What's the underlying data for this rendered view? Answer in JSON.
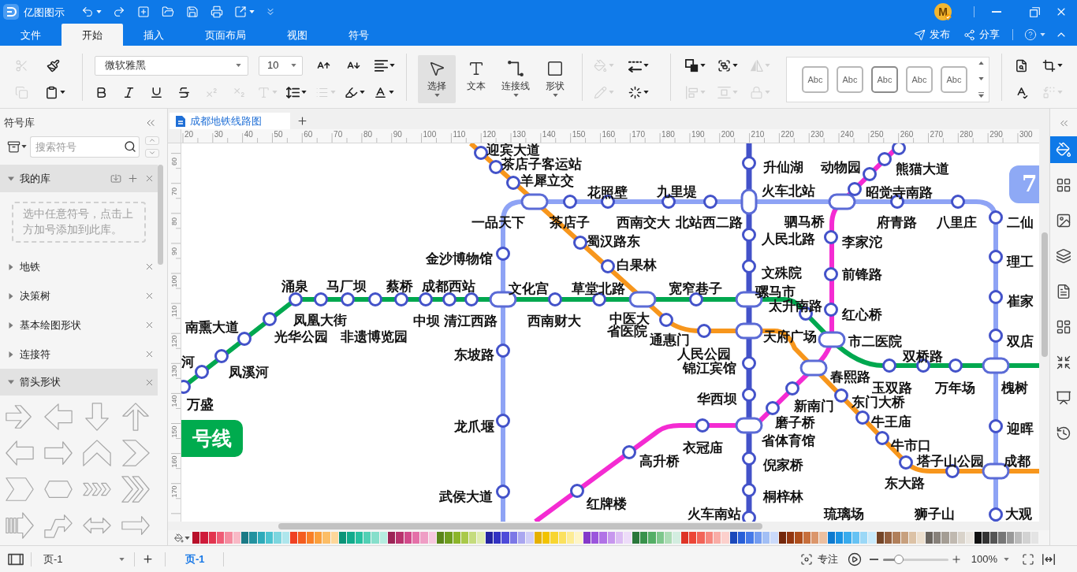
{
  "title_bar": {
    "app_name": "亿图图示",
    "avatar_initial": "M"
  },
  "menu": {
    "tabs": [
      {
        "label": "文件",
        "selected": false
      },
      {
        "label": "开始",
        "selected": true
      },
      {
        "label": "插入",
        "selected": false
      },
      {
        "label": "页面布局",
        "selected": false
      },
      {
        "label": "视图",
        "selected": false
      },
      {
        "label": "符号",
        "selected": false
      }
    ],
    "actions": [
      {
        "kind": "publish",
        "label": "发布"
      },
      {
        "kind": "share",
        "label": "分享"
      }
    ]
  },
  "toolbar": {
    "clipboard": [
      {
        "kind": "cut",
        "disabled": true
      },
      {
        "kind": "format_painter",
        "disabled": false
      },
      {
        "kind": "copy",
        "disabled": true
      },
      {
        "kind": "paste",
        "disabled": false
      }
    ],
    "font_family": "微软雅黑",
    "font_size": "10",
    "font_tools": [
      {
        "kind": "grow_font",
        "disabled": false
      },
      {
        "kind": "shrink_font",
        "disabled": false
      },
      {
        "kind": "align_text",
        "disabled": false
      }
    ],
    "format_tools": [
      {
        "kind": "bold",
        "disabled": false
      },
      {
        "kind": "italic",
        "disabled": false
      },
      {
        "kind": "underline",
        "disabled": false
      },
      {
        "kind": "strikethrough",
        "disabled": false
      },
      {
        "kind": "superscript",
        "disabled": true
      },
      {
        "kind": "subscript",
        "disabled": true
      },
      {
        "kind": "text_style",
        "disabled": true
      },
      {
        "kind": "line_spacing",
        "disabled": false
      },
      {
        "kind": "bullets",
        "disabled": true
      },
      {
        "kind": "highlight",
        "disabled": false
      },
      {
        "kind": "font_color",
        "disabled": false
      }
    ],
    "tools": [
      {
        "kind": "select",
        "label": "选择",
        "selected": true
      },
      {
        "kind": "text",
        "label": "文本",
        "selected": false
      },
      {
        "kind": "connector",
        "label": "连接线",
        "selected": false
      },
      {
        "kind": "shape",
        "label": "形状",
        "selected": false
      }
    ],
    "shape_style": [
      {
        "kind": "fill",
        "disabled": true
      },
      {
        "kind": "line_style",
        "disabled": false
      },
      {
        "kind": "line_color",
        "disabled": true
      },
      {
        "kind": "effects",
        "disabled": false
      }
    ],
    "arrange": [
      {
        "kind": "bring_front",
        "disabled": false
      },
      {
        "kind": "group",
        "disabled": false
      },
      {
        "kind": "flip",
        "disabled": true
      },
      {
        "kind": "align_objects",
        "disabled": true
      },
      {
        "kind": "distribute",
        "disabled": true
      },
      {
        "kind": "lock",
        "disabled": true
      }
    ],
    "style_presets": [
      "Abc",
      "Abc",
      "Abc",
      "Abc",
      "Abc"
    ],
    "extras": [
      {
        "kind": "find",
        "disabled": false
      },
      {
        "kind": "crop",
        "disabled": false
      },
      {
        "kind": "spellcheck",
        "disabled": false
      },
      {
        "kind": "replace",
        "disabled": true
      }
    ]
  },
  "sidebar": {
    "title": "符号库",
    "search": {
      "placeholder": "搜索符号"
    },
    "my_library": {
      "title": "我的库",
      "expanded": true,
      "hint": "选中任意符号，点击上方加号添加到此库。"
    },
    "libraries": [
      {
        "title": "地铁",
        "expanded": false
      },
      {
        "title": "决策树",
        "expanded": false
      },
      {
        "title": "基本绘图形状",
        "expanded": false
      },
      {
        "title": "连接符",
        "expanded": false
      },
      {
        "title": "箭头形状",
        "expanded": true
      }
    ]
  },
  "document_tabs": [
    {
      "title": "成都地铁线路图",
      "selected": true
    }
  ],
  "ruler": {
    "x_ticks": [
      "20",
      "30",
      "40",
      "50",
      "60",
      "70",
      "80",
      "90",
      "100",
      "110",
      "120",
      "130",
      "140",
      "150",
      "160",
      "170",
      "180",
      "190",
      "200",
      "210",
      "220",
      "230",
      "240",
      "250",
      "260",
      "270",
      "280",
      "290",
      "300"
    ],
    "y_ticks": [
      "60",
      "70",
      "80",
      "90",
      "100",
      "110",
      "120",
      "130",
      "140",
      "150",
      "160",
      "170"
    ]
  },
  "map": {
    "lines": [
      {
        "color": "#4352c9"
      },
      {
        "color": "#8ea3f5"
      },
      {
        "color": "#00a84f"
      },
      {
        "color": "#f7961c"
      },
      {
        "color": "#f42bd2"
      }
    ],
    "stations": [
      "迎宾大道",
      "茶店子客运站",
      "升仙湖",
      "动物园",
      "熊猫大道",
      "羊犀立交",
      "花照壁",
      "九里堤",
      "火车北站",
      "昭觉寺南路",
      "一品天下",
      "茶店子",
      "西南交大",
      "北站西二路",
      "驷马桥",
      "府青路",
      "八里庄",
      "二仙",
      "蜀汉路东",
      "人民北路",
      "李家沱",
      "金沙博物馆",
      "白果林",
      "理工",
      "文殊院",
      "前锋路",
      "涌泉",
      "马厂坝",
      "蔡桥",
      "成都西站",
      "文化宫",
      "草堂北路",
      "宽窄巷子",
      "骡马市",
      "太升南路",
      "崔家",
      "南熏大道",
      "凤凰大街",
      "中坝",
      "清江西路",
      "西南财大",
      "中医大",
      "红心桥",
      "光华公园",
      "非遗博览园",
      "省医院",
      "通惠门",
      "天府广场",
      "市二医院",
      "双店",
      "河",
      "东坡路",
      "人民公园",
      "双桥路",
      "凤溪河",
      "锦江宾馆",
      "春熙路",
      "玉双路",
      "万年场",
      "槐树",
      "万盛",
      "华西坝",
      "新南门",
      "东门大桥",
      "龙爪堰",
      "磨子桥",
      "牛王庙",
      "迎晖",
      "衣冠庙",
      "省体育馆",
      "牛市口",
      "高升桥",
      "倪家桥",
      "塔子山公园",
      "成都",
      "东大路",
      "武侯大道",
      "红牌楼",
      "桐梓林",
      "火车南站",
      "琉璃场",
      "狮子山",
      "大观"
    ],
    "badges": [
      {
        "text": "号线",
        "color": "#00ab4e"
      },
      {
        "text": "7",
        "color": "#8ea9f5"
      }
    ]
  },
  "right_panel": [
    {
      "kind": "style",
      "selected": true
    },
    {
      "kind": "symbols",
      "selected": false
    },
    {
      "kind": "image",
      "selected": false
    },
    {
      "kind": "layers",
      "selected": false
    },
    {
      "kind": "page",
      "selected": false
    },
    {
      "kind": "data",
      "selected": false
    },
    {
      "kind": "fit",
      "selected": false
    },
    {
      "kind": "present",
      "selected": false
    },
    {
      "kind": "history",
      "selected": false
    }
  ],
  "palette": [
    {
      "color": "#b8102a"
    },
    {
      "color": "#cf1b3a"
    },
    {
      "color": "#e2354f"
    },
    {
      "color": "#ef5c76"
    },
    {
      "color": "#f58ca0"
    },
    {
      "color": "#f9b9c6"
    },
    {
      "color": "#1b7a86"
    },
    {
      "color": "#23929f"
    },
    {
      "color": "#2eabba"
    },
    {
      "color": "#4cc3d0"
    },
    {
      "color": "#7dd6df"
    },
    {
      "color": "#aee6ec"
    },
    {
      "color": "#ef4123"
    },
    {
      "color": "#f45d1f"
    },
    {
      "color": "#f97f27"
    },
    {
      "color": "#fb9f3c"
    },
    {
      "color": "#fcbd66"
    },
    {
      "color": "#fdd79a"
    },
    {
      "color": "#0b9478"
    },
    {
      "color": "#12ab8c"
    },
    {
      "color": "#27c0a0"
    },
    {
      "color": "#52d0b5"
    },
    {
      "color": "#86dfcb"
    },
    {
      "color": "#b6ece0"
    },
    {
      "color": "#9c2456"
    },
    {
      "color": "#b8336d"
    },
    {
      "color": "#d24a8b"
    },
    {
      "color": "#e470a8"
    },
    {
      "color": "#ef9ec5"
    },
    {
      "color": "#f7c8de"
    },
    {
      "color": "#5a8519"
    },
    {
      "color": "#6f9d1f"
    },
    {
      "color": "#8cb52a"
    },
    {
      "color": "#a9c94a"
    },
    {
      "color": "#c5dc7e"
    },
    {
      "color": "#dfecb0"
    },
    {
      "color": "#2424a0"
    },
    {
      "color": "#3333c2"
    },
    {
      "color": "#4e4bd9"
    },
    {
      "color": "#7c78e6"
    },
    {
      "color": "#aaa7f0"
    },
    {
      "color": "#d0cef7"
    },
    {
      "color": "#e5b000"
    },
    {
      "color": "#f2c300"
    },
    {
      "color": "#f8d530"
    },
    {
      "color": "#fbe15f"
    },
    {
      "color": "#fdec95"
    },
    {
      "color": "#fef5c6"
    },
    {
      "color": "#8439c9"
    },
    {
      "color": "#9b55dc"
    },
    {
      "color": "#b173e6"
    },
    {
      "color": "#c797ee"
    },
    {
      "color": "#dcbdf4"
    },
    {
      "color": "#eddcf9"
    },
    {
      "color": "#2a773b"
    },
    {
      "color": "#38924b"
    },
    {
      "color": "#54ae66"
    },
    {
      "color": "#7ec78c"
    },
    {
      "color": "#acdcb5"
    },
    {
      "color": "#d3ede0"
    },
    {
      "color": "#de3427"
    },
    {
      "color": "#ec4637"
    },
    {
      "color": "#f26458"
    },
    {
      "color": "#f6877e"
    },
    {
      "color": "#f9aca6"
    },
    {
      "color": "#fcd0cc"
    },
    {
      "color": "#1b48ba"
    },
    {
      "color": "#285fd8"
    },
    {
      "color": "#4579e8"
    },
    {
      "color": "#739cf0"
    },
    {
      "color": "#a2bff5"
    },
    {
      "color": "#cbdafa"
    },
    {
      "color": "#74270b"
    },
    {
      "color": "#933610"
    },
    {
      "color": "#ae4e1c"
    },
    {
      "color": "#c76f3c"
    },
    {
      "color": "#db966b"
    },
    {
      "color": "#ebbfa0"
    },
    {
      "color": "#0d7acf"
    },
    {
      "color": "#1a92e3"
    },
    {
      "color": "#39abed"
    },
    {
      "color": "#66c2f3"
    },
    {
      "color": "#9bd8f7"
    },
    {
      "color": "#c9eafb"
    },
    {
      "color": "#754628"
    },
    {
      "color": "#94603f"
    },
    {
      "color": "#b07f5a"
    },
    {
      "color": "#c7a07e"
    },
    {
      "color": "#dcc2a6"
    },
    {
      "color": "#ede0cf"
    },
    {
      "color": "#6a655f"
    },
    {
      "color": "#87817a"
    },
    {
      "color": "#a49d94"
    },
    {
      "color": "#c0b9b0"
    },
    {
      "color": "#d9d3ca"
    },
    {
      "color": "#ebe7e1"
    },
    {
      "color": "#111111"
    },
    {
      "color": "#333333"
    },
    {
      "color": "#555555"
    },
    {
      "color": "#777777"
    },
    {
      "color": "#999999"
    },
    {
      "color": "#bbbbbb"
    },
    {
      "color": "#d2d2d2"
    },
    {
      "color": "#e4e4e4"
    }
  ],
  "status_bar": {
    "page_menu": "页-1",
    "pages": [
      {
        "label": "页-1",
        "selected": true
      }
    ],
    "focus_label": "专注",
    "zoom": {
      "level": 0.24,
      "reading": "100%"
    }
  }
}
